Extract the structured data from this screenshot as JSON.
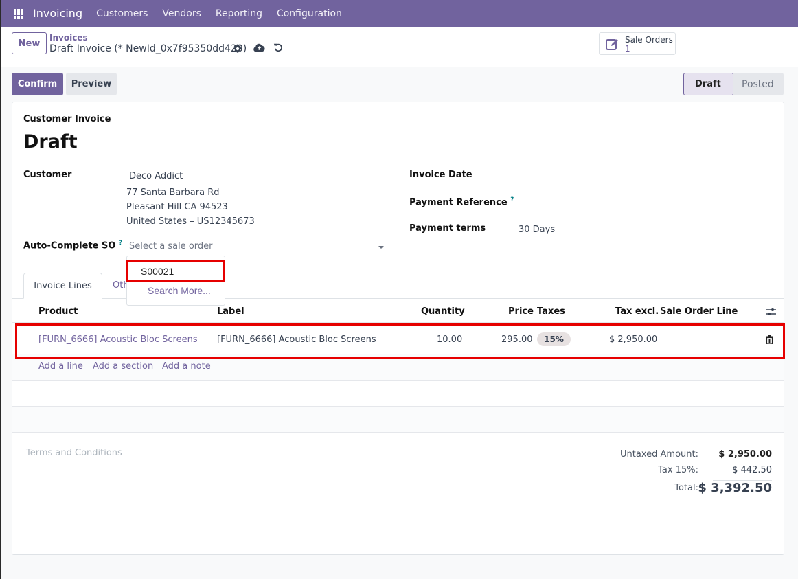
{
  "navbar": {
    "app_name": "Invoicing",
    "menu": [
      "Customers",
      "Vendors",
      "Reporting",
      "Configuration"
    ]
  },
  "control_panel": {
    "new_label": "New",
    "breadcrumb": "Invoices",
    "record_title": "Draft Invoice (* NewId_0x7f95350dd420)",
    "smart_button": {
      "label": "Sale Orders",
      "count": "1"
    }
  },
  "actions": {
    "confirm_label": "Confirm",
    "preview_label": "Preview"
  },
  "statusbar": {
    "stages": [
      "Draft",
      "Posted"
    ],
    "current": "Draft"
  },
  "form": {
    "move_type": "Customer Invoice",
    "name": "Draft",
    "customer": {
      "label": "Customer",
      "name": "Deco Addict",
      "address": [
        "77 Santa Barbara Rd",
        "Pleasant Hill CA 94523",
        "United States – US12345673"
      ]
    },
    "auto_complete_so": {
      "label": "Auto-Complete SO",
      "tooltip": "?",
      "placeholder": "Select a sale order",
      "dropdown_options": [
        "S00021"
      ],
      "search_more": "Search More..."
    },
    "invoice_date": {
      "label": "Invoice Date",
      "value": ""
    },
    "payment_reference": {
      "label": "Payment Reference",
      "tooltip": "?",
      "value": ""
    },
    "payment_terms": {
      "label": "Payment terms",
      "value": "30 Days"
    }
  },
  "tabs": [
    {
      "label": "Invoice Lines",
      "active": true
    },
    {
      "label": "Other Info",
      "visible_text": "Oth",
      "active": false
    }
  ],
  "invoice_lines": {
    "columns": [
      "Product",
      "Label",
      "Quantity",
      "Price",
      "Taxes",
      "Tax excl.",
      "Sale Order Line"
    ],
    "rows": [
      {
        "product": "[FURN_6666] Acoustic Bloc Screens",
        "label": "[FURN_6666] Acoustic Bloc Screens",
        "quantity": "10.00",
        "price": "295.00",
        "taxes": "15%",
        "tax_excl": "$ 2,950.00",
        "sale_order_line": ""
      }
    ],
    "add_links": [
      "Add a line",
      "Add a section",
      "Add a note"
    ]
  },
  "terms_placeholder": "Terms and Conditions",
  "totals": {
    "untaxed_label": "Untaxed Amount:",
    "untaxed_value": "$ 2,950.00",
    "tax_label": "Tax 15%:",
    "tax_value": "$ 442.50",
    "total_label": "Total:",
    "total_value": "$ 3,392.50"
  },
  "colors": {
    "brand": "#71639e",
    "highlight": "#e60000",
    "tooltip": "#017e84"
  }
}
